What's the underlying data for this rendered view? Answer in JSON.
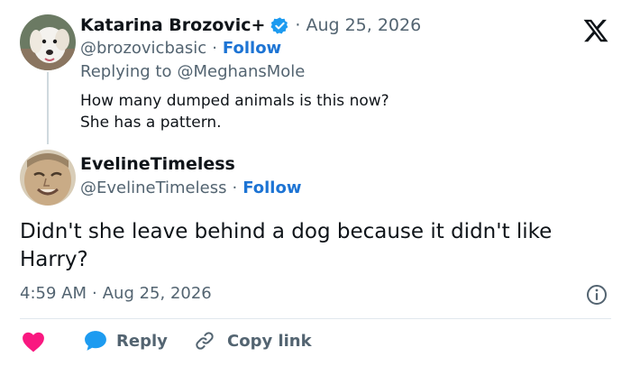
{
  "parent_tweet": {
    "author_name": "Katarina Brozovic+",
    "date": "Aug 25, 2026",
    "handle": "@brozovicbasic",
    "follow_label": "Follow",
    "replying_to_prefix": "Replying to",
    "replying_to_handle": "@MeghansMole",
    "text_line1": "How many dumped animals is this now?",
    "text_line2": "She has a pattern."
  },
  "main_tweet": {
    "author_name": "EvelineTimeless",
    "handle": "@EvelineTimeless",
    "follow_label": "Follow",
    "text_line1": "Didn't she leave behind a dog because it didn't like",
    "text_line2": "Harry?",
    "time": "4:59 AM",
    "date": "Aug 25, 2026"
  },
  "actions": {
    "reply_label": "Reply",
    "copy_link_label": "Copy link"
  },
  "separator": "·",
  "icons": {
    "logo": "x-logo-icon",
    "verified": "verified-badge-icon",
    "info": "info-icon",
    "like": "heart-icon",
    "reply": "speech-bubble-icon",
    "copy_link": "link-icon"
  },
  "colors": {
    "link_blue": "#1d74d4",
    "muted_text": "#536471",
    "heart": "#f91880",
    "verified": "#1d9bf0"
  }
}
